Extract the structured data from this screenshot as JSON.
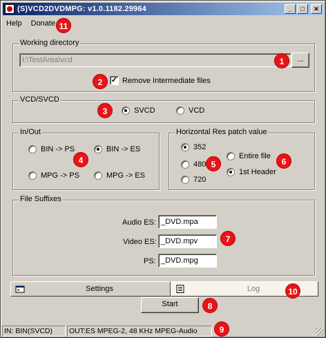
{
  "window": {
    "title": "(S)VCD2DVDMPG: v1.0.1182.29964",
    "controls": {
      "minimize": "_",
      "maximize": "□",
      "close": "✕"
    }
  },
  "menu": {
    "help": "Help",
    "donate": "Donate"
  },
  "working_dir": {
    "legend": "Working directory",
    "path": "I:\\TestArea\\vcd",
    "browse": "...",
    "remove_intermediate": {
      "label": "Remove Intermediate files",
      "checked": true
    }
  },
  "vcd_svcd": {
    "legend": "VCD/SVCD",
    "options": [
      {
        "label": "SVCD",
        "selected": true
      },
      {
        "label": "VCD",
        "selected": false
      }
    ]
  },
  "in_out": {
    "legend": "In/Out",
    "options": [
      {
        "label": "BIN -> PS",
        "selected": false
      },
      {
        "label": "BIN -> ES",
        "selected": true
      },
      {
        "label": "MPG -> PS",
        "selected": false
      },
      {
        "label": "MPG -> ES",
        "selected": false
      }
    ]
  },
  "hres": {
    "legend": "Horizontal Res patch value",
    "values": [
      {
        "label": "352",
        "selected": true
      },
      {
        "label": "480",
        "selected": false
      },
      {
        "label": "720",
        "selected": false
      }
    ],
    "scope": [
      {
        "label": "Entire file",
        "selected": false
      },
      {
        "label": "1st Header",
        "selected": true
      }
    ]
  },
  "suffixes": {
    "legend": "File Suffixes",
    "audio": {
      "label": "Audio ES:",
      "value": "_DVD.mpa"
    },
    "video": {
      "label": "Video ES:",
      "value": "_DVD.mpv"
    },
    "ps": {
      "label": "PS:",
      "value": "_DVD.mpg"
    }
  },
  "tabs": {
    "settings": "Settings",
    "log": "Log"
  },
  "start": "Start",
  "status": {
    "in": "IN: BIN(SVCD)",
    "out": "OUT:ES MPEG-2, 48 KHz MPEG-Audio"
  },
  "badges": [
    "1",
    "2",
    "3",
    "4",
    "5",
    "6",
    "7",
    "8",
    "9",
    "10",
    "11"
  ],
  "colors": {
    "title_start": "#0a246a",
    "title_end": "#a6caf0",
    "badge": "#e8141a",
    "face": "#d4d0c8"
  }
}
